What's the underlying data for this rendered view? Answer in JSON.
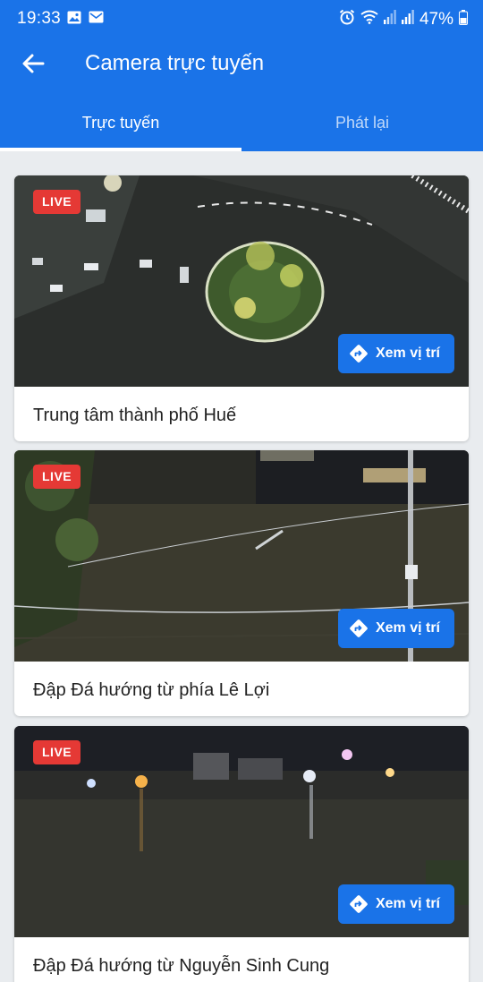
{
  "status_bar": {
    "time": "19:33",
    "left_icons": [
      "image-icon",
      "mail-icon"
    ],
    "right_icons": [
      "alarm-icon",
      "wifi-icon",
      "signal-icon",
      "signal-icon",
      "battery-icon"
    ],
    "battery": "47%"
  },
  "app_bar": {
    "title": "Camera trực tuyến",
    "back_icon": "arrow-left-icon"
  },
  "tabs": [
    {
      "label": "Trực tuyến",
      "selected": true
    },
    {
      "label": "Phát lại",
      "selected": false
    }
  ],
  "cameras": [
    {
      "badge": "LIVE",
      "button": "Xem vị trí",
      "title": "Trung tâm thành phố Huế"
    },
    {
      "badge": "LIVE",
      "button": "Xem vị trí",
      "title": "Đập Đá hướng từ phía Lê Lợi"
    },
    {
      "badge": "LIVE",
      "button": "Xem vị trí",
      "title": "Đập Đá hướng từ Nguyễn Sinh Cung"
    }
  ],
  "colors": {
    "primary": "#1a73e8",
    "live_badge": "#e53935",
    "background": "#e9ecef"
  }
}
